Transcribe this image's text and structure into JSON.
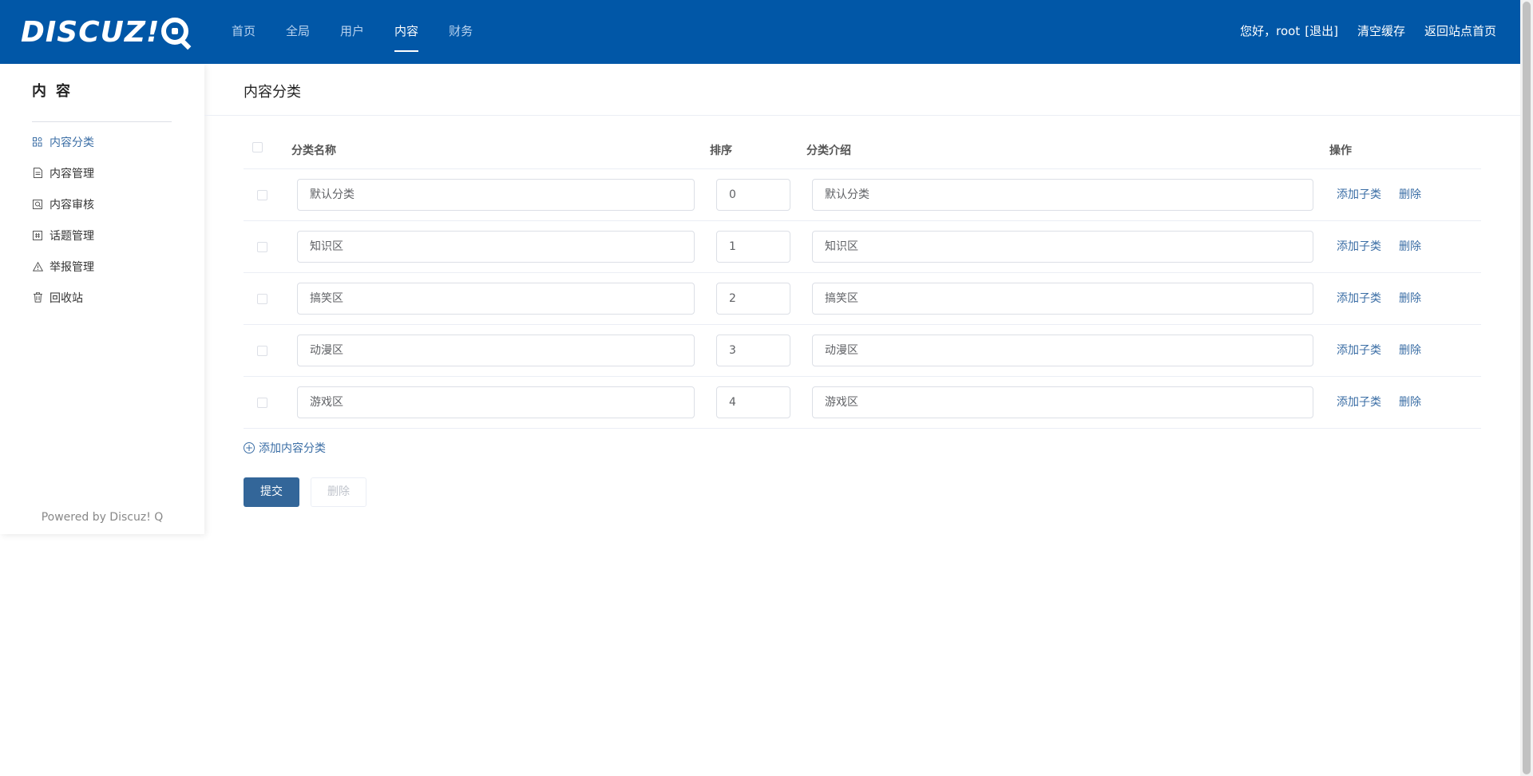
{
  "header": {
    "logo_text": "DISCUZ!",
    "nav": [
      {
        "label": "首页"
      },
      {
        "label": "全局"
      },
      {
        "label": "用户"
      },
      {
        "label": "内容",
        "active": true
      },
      {
        "label": "财务"
      }
    ],
    "greeting": "您好，root",
    "logout": "[退出]",
    "clear_cache": "清空缓存",
    "back_home": "返回站点首页"
  },
  "sidebar": {
    "title": "内容",
    "items": [
      {
        "label": "内容分类",
        "icon": "category-icon",
        "active": true
      },
      {
        "label": "内容管理",
        "icon": "document-icon"
      },
      {
        "label": "内容审核",
        "icon": "review-icon"
      },
      {
        "label": "话题管理",
        "icon": "topic-icon"
      },
      {
        "label": "举报管理",
        "icon": "warning-icon"
      },
      {
        "label": "回收站",
        "icon": "trash-icon"
      }
    ],
    "powered": "Powered by Discuz! Q"
  },
  "main": {
    "title": "内容分类",
    "columns": {
      "name": "分类名称",
      "order": "排序",
      "desc": "分类介绍",
      "ops": "操作"
    },
    "rows": [
      {
        "name": "默认分类",
        "order": "0",
        "desc": "默认分类"
      },
      {
        "name": "知识区",
        "order": "1",
        "desc": "知识区"
      },
      {
        "name": "搞笑区",
        "order": "2",
        "desc": "搞笑区"
      },
      {
        "name": "动漫区",
        "order": "3",
        "desc": "动漫区"
      },
      {
        "name": "游戏区",
        "order": "4",
        "desc": "游戏区"
      }
    ],
    "add_sub": "添加子类",
    "delete": "删除",
    "add_category": "添加内容分类",
    "submit": "提交",
    "bulk_delete": "删除"
  },
  "colors": {
    "brand": "#0157a7",
    "link": "#3b6ea5",
    "submit": "#336699"
  }
}
